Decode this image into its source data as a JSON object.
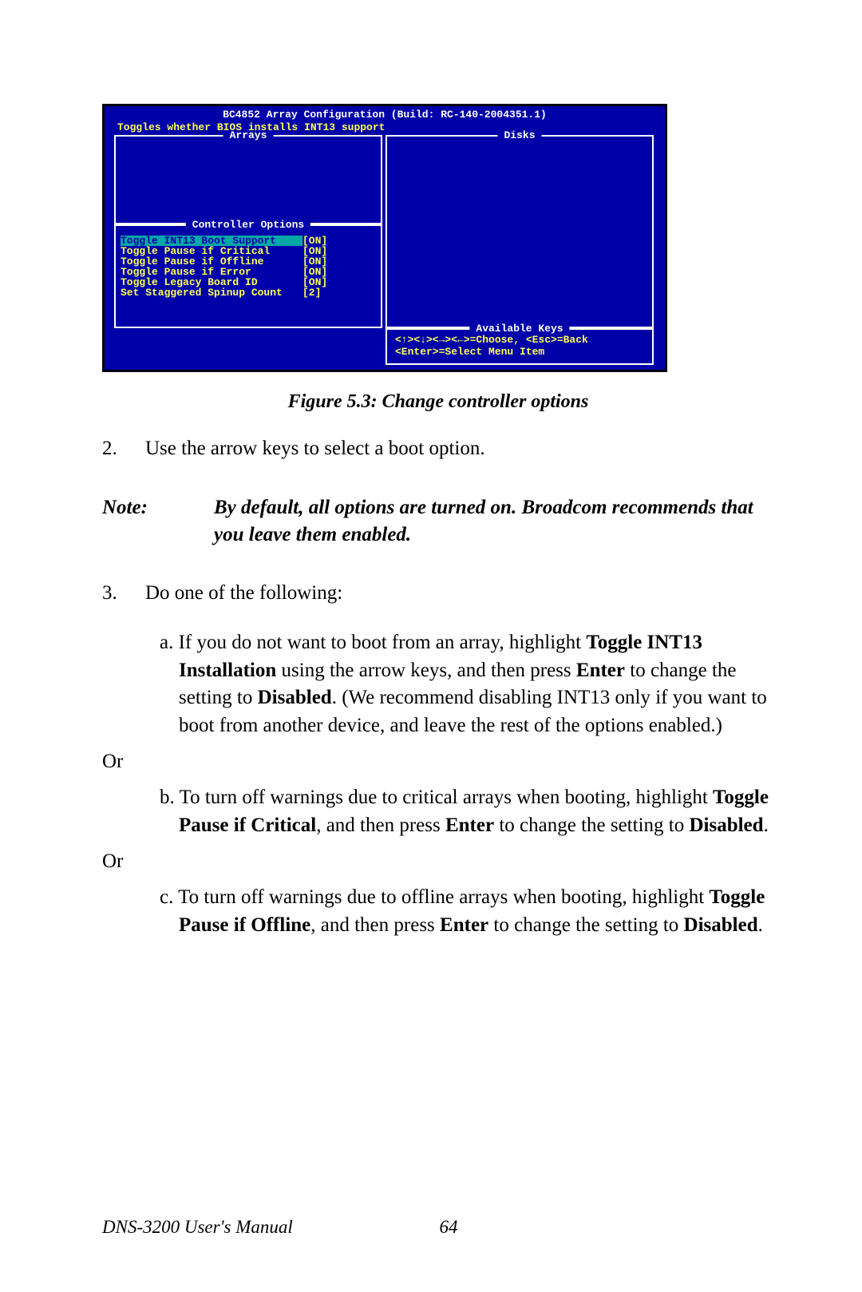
{
  "bios": {
    "title": "BC4852 Array Configuration (Build: RC-140-2004351.1)",
    "subtitle": "Toggles whether BIOS installs INT13 support",
    "panels": {
      "arrays": "Arrays",
      "disks": "Disks",
      "controller": "Controller Options",
      "keys": "Available Keys"
    },
    "controller_options": [
      {
        "name": "Toggle INT13 Boot Support",
        "value": "[ON]",
        "selected": true
      },
      {
        "name": "Toggle Pause if Critical",
        "value": "[ON]",
        "selected": false
      },
      {
        "name": "Toggle Pause if Offline",
        "value": "[ON]",
        "selected": false
      },
      {
        "name": "Toggle Pause if Error",
        "value": "[ON]",
        "selected": false
      },
      {
        "name": "Toggle Legacy Board ID",
        "value": "[ON]",
        "selected": false
      },
      {
        "name": "Set Staggered Spinup Count",
        "value": "[2]",
        "selected": false
      }
    ],
    "keys_text": "<↑><↓><→><←>=Choose, <Esc>=Back\n<Enter>=Select Menu Item"
  },
  "caption": "Figure 5.3: Change controller options",
  "step2_num": "2.",
  "step2_text": "Use the arrow keys to select a boot option.",
  "note_label": "Note:",
  "note_text": "By default, all options are turned on. Broadcom recommends that you leave them enabled.",
  "step3_num": "3.",
  "step3_text": "Do one of the following:",
  "sub_a_pre": "a. If you do not want to boot from an array, highlight ",
  "sub_a_b1": "Toggle INT13 Installation",
  "sub_a_mid1": " using the arrow keys, and then press ",
  "sub_a_b2": "Enter",
  "sub_a_mid2": " to change the setting to ",
  "sub_a_b3": "Disabled",
  "sub_a_post": ". (We recommend disabling INT13 only if you want to boot from another device, and leave the rest of the options enabled.)",
  "or": "Or",
  "sub_b_pre": "b. To turn off warnings due to critical arrays when booting, highlight ",
  "sub_b_b1": "Toggle Pause if Critical",
  "sub_b_mid1": ", and then press ",
  "sub_b_b2": "Enter",
  "sub_b_mid2": " to change the setting to ",
  "sub_b_b3": "Disabled",
  "sub_b_post": ".",
  "sub_c_pre": "c. To turn off warnings due to offline arrays when booting, highlight ",
  "sub_c_b1": "Toggle Pause if Offline",
  "sub_c_mid1": ", and then press ",
  "sub_c_b2": "Enter",
  "sub_c_mid2": " to change the setting to ",
  "sub_c_b3": "Disabled",
  "sub_c_post": ".",
  "footer_title": "DNS-3200 User's Manual",
  "footer_page": "64"
}
